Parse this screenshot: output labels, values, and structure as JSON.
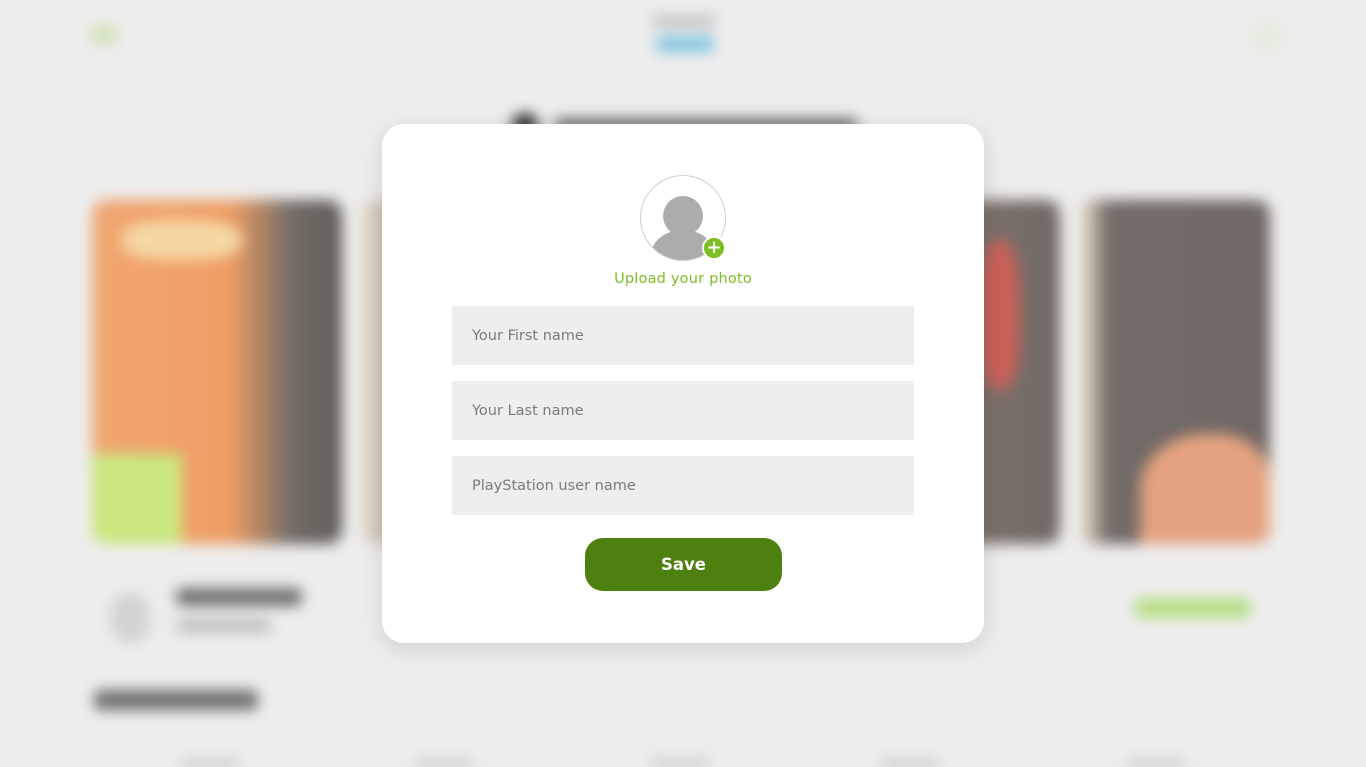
{
  "modal": {
    "upload_photo_label": "Upload your photo",
    "add_icon_glyph": "+",
    "fields": {
      "first_name_placeholder": "Your First name",
      "last_name_placeholder": "Your Last name",
      "psn_username_placeholder": "PlayStation user name"
    },
    "save_label": "Save"
  },
  "colors": {
    "accent": "#7cbf22",
    "button": "#4e800f",
    "field_bg": "#eeeeee",
    "backdrop": "#ededed"
  },
  "icons": {
    "avatar": "user-placeholder-icon",
    "add": "plus-icon",
    "menu": "hamburger-menu-icon",
    "profile": "user-icon"
  }
}
